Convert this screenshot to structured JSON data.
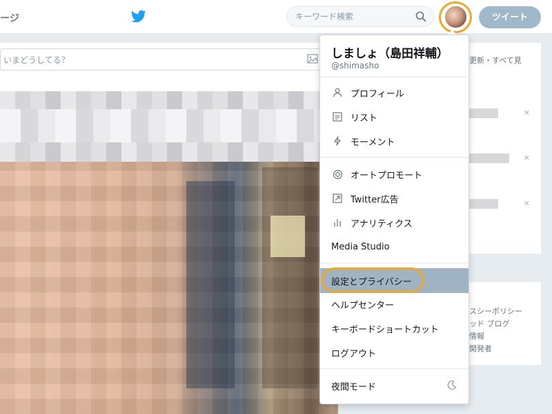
{
  "header": {
    "nav_partial": "ージ",
    "search_placeholder": "キーワード検索",
    "tweet_button": "ツイート"
  },
  "timeline": {
    "compose_placeholder": "いまどうしてる？"
  },
  "sidebar": {
    "trends_header_partial": "更新・すべて見",
    "footer_lines": [
      "スシーポリシー",
      "ッド  ブログ",
      "情報",
      "開発者"
    ]
  },
  "account_menu": {
    "display_name": "しましょ（島田祥輔）",
    "handle": "@shimasho",
    "groups": [
      [
        {
          "label": "プロフィール",
          "icon": "person-icon"
        },
        {
          "label": "リスト",
          "icon": "list-icon"
        },
        {
          "label": "モーメント",
          "icon": "lightning-icon"
        }
      ],
      [
        {
          "label": "オートプロモート",
          "icon": "autopromote-icon"
        },
        {
          "label": "Twitter広告",
          "icon": "arrow-box-icon"
        },
        {
          "label": "アナリティクス",
          "icon": "bar-chart-icon"
        },
        {
          "label": "Media Studio",
          "icon": ""
        }
      ],
      [
        {
          "label": "設定とプライバシー",
          "icon": "",
          "active": true
        },
        {
          "label": "ヘルプセンター",
          "icon": ""
        },
        {
          "label": "キーボードショートカット",
          "icon": ""
        },
        {
          "label": "ログアウト",
          "icon": ""
        }
      ]
    ],
    "night_mode": {
      "label": "夜間モード",
      "icon": "moon-icon"
    }
  },
  "colors": {
    "highlight_ring": "#f5a623",
    "active_item_bg": "#9fb3c2",
    "tweet_button_bg": "#9fb9cb",
    "brand_blue": "#1da1f2"
  }
}
